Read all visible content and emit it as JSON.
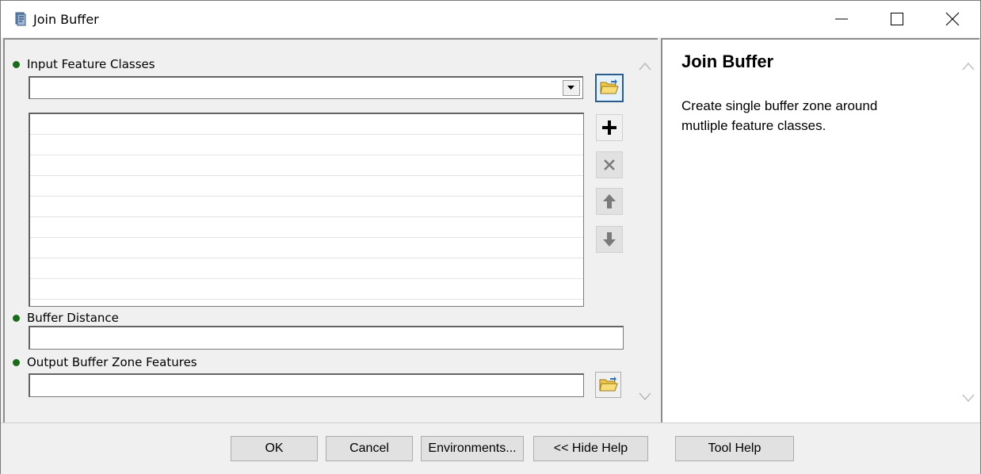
{
  "window": {
    "title": "Join Buffer"
  },
  "params": {
    "input_feature_classes": {
      "label": "Input Feature Classes",
      "value": ""
    },
    "buffer_distance": {
      "label": "Buffer Distance",
      "value": ""
    },
    "output_features": {
      "label": "Output Buffer Zone Features",
      "value": ""
    }
  },
  "help": {
    "title": "Join Buffer",
    "text": "Create single buffer zone around mutliple feature classes."
  },
  "buttons": {
    "ok": "OK",
    "cancel": "Cancel",
    "environments": "Environments...",
    "hide_help": "<< Hide Help",
    "tool_help": "Tool Help"
  },
  "colors": {
    "required_dot": "#1a6b1a",
    "folder": "#e8b830"
  }
}
